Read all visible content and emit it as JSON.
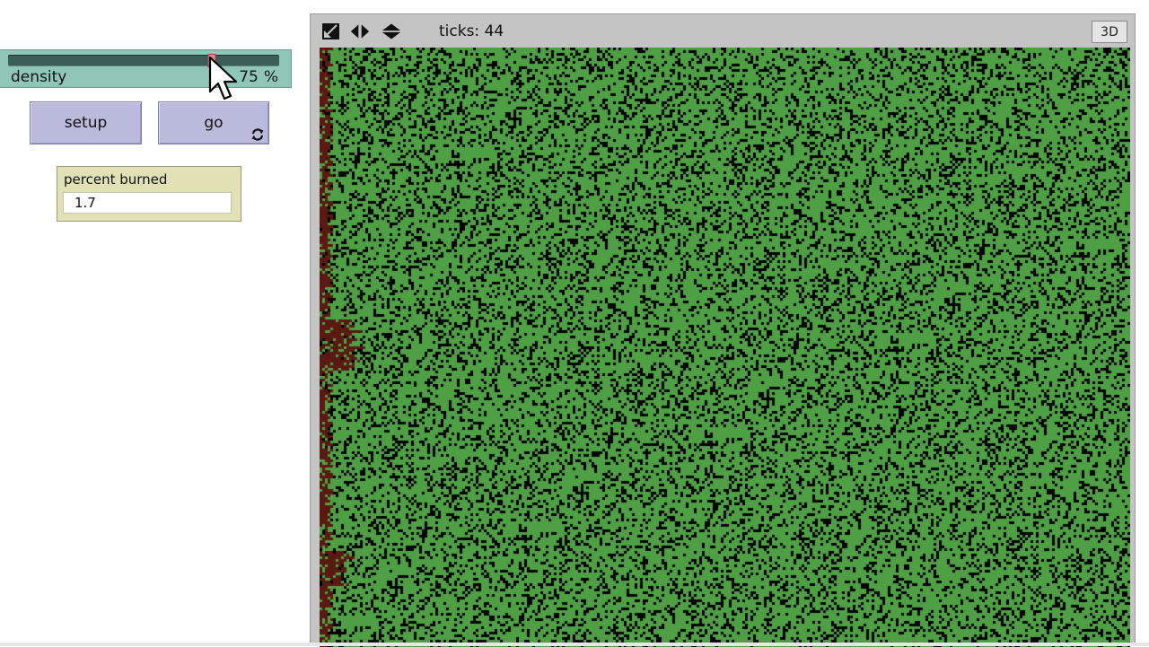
{
  "slider": {
    "label": "density",
    "value": "75",
    "unit": "%",
    "min": 0,
    "max": 100,
    "fraction": 0.75
  },
  "buttons": {
    "setup_label": "setup",
    "go_label": "go",
    "go_forever_icon": "forever-loop-icon"
  },
  "monitor": {
    "label": "percent burned",
    "value": "1.7"
  },
  "view": {
    "ticks_label": "ticks: 44",
    "toggle_3d_label": "3D",
    "toolbar_icons": [
      "shrink-view-icon",
      "horizontal-resize-icon",
      "vertical-resize-icon"
    ],
    "colors": {
      "tree": "#4fa044",
      "empty": "#000000",
      "burned": "#5a1a12"
    }
  }
}
